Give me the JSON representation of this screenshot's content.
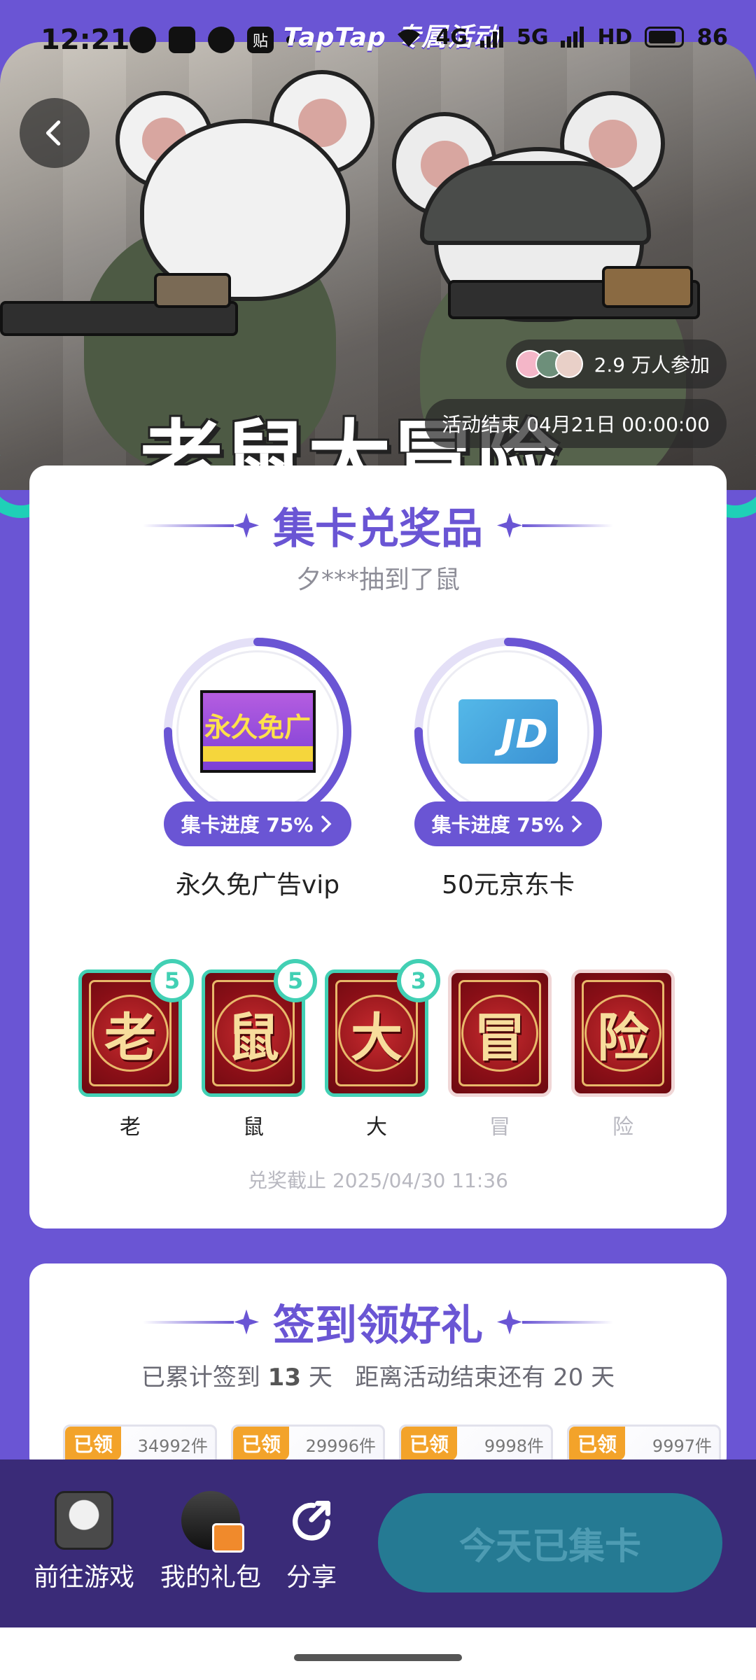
{
  "status_bar": {
    "time": "12:21",
    "banner": "TapTap 专属活动",
    "icons": [
      "wechat-icon",
      "qq-icon",
      "message-icon",
      "tieba-icon",
      "dot-icon"
    ],
    "tieba_glyph": "贴",
    "network_1": "4G",
    "network_2": "5G",
    "hd": "HD",
    "battery": "86"
  },
  "hero": {
    "title": "老鼠大冒险",
    "participants": "2.9 万人参加",
    "end_time": "活动结束 04月21日 00:00:00"
  },
  "collect": {
    "title": "集卡兑奖品",
    "ticker": "夕***抽到了鼠",
    "prizes": [
      {
        "name": "永久免广告vip",
        "image_text": "永久免广",
        "progress_label": "集卡进度 75%",
        "progress": 0.75
      },
      {
        "name": "50元京东卡",
        "image_text": "JD",
        "progress_label": "集卡进度 75%",
        "progress": 0.75
      }
    ],
    "cards": [
      {
        "char": "老",
        "label": "老",
        "count": "5"
      },
      {
        "char": "鼠",
        "label": "鼠",
        "count": "5"
      },
      {
        "char": "大",
        "label": "大",
        "count": "3"
      },
      {
        "char": "冒",
        "label": "冒",
        "count": ""
      },
      {
        "char": "险",
        "label": "险",
        "count": ""
      }
    ],
    "deadline": "兑奖截止 2025/04/30 11:36"
  },
  "checkin": {
    "title": "签到领好礼",
    "prefix": "已累计签到",
    "days": "13",
    "unit": "天",
    "remaining": "距离活动结束还有 20 天",
    "claims": [
      {
        "tag": "已领",
        "count": "34992件"
      },
      {
        "tag": "已领",
        "count": "29996件"
      },
      {
        "tag": "已领",
        "count": "9998件"
      },
      {
        "tag": "已领",
        "count": "9997件"
      }
    ]
  },
  "bottom_bar": {
    "game_label": "前往游戏",
    "gift_label": "我的礼包",
    "share_label": "分享",
    "cta_label": "今天已集卡"
  },
  "colors": {
    "primary": "#6a55d4",
    "accent_teal": "#42d0b4",
    "card_red": "#8a0f17",
    "claim_orange": "#f3a32a",
    "cta": "#257a93"
  }
}
